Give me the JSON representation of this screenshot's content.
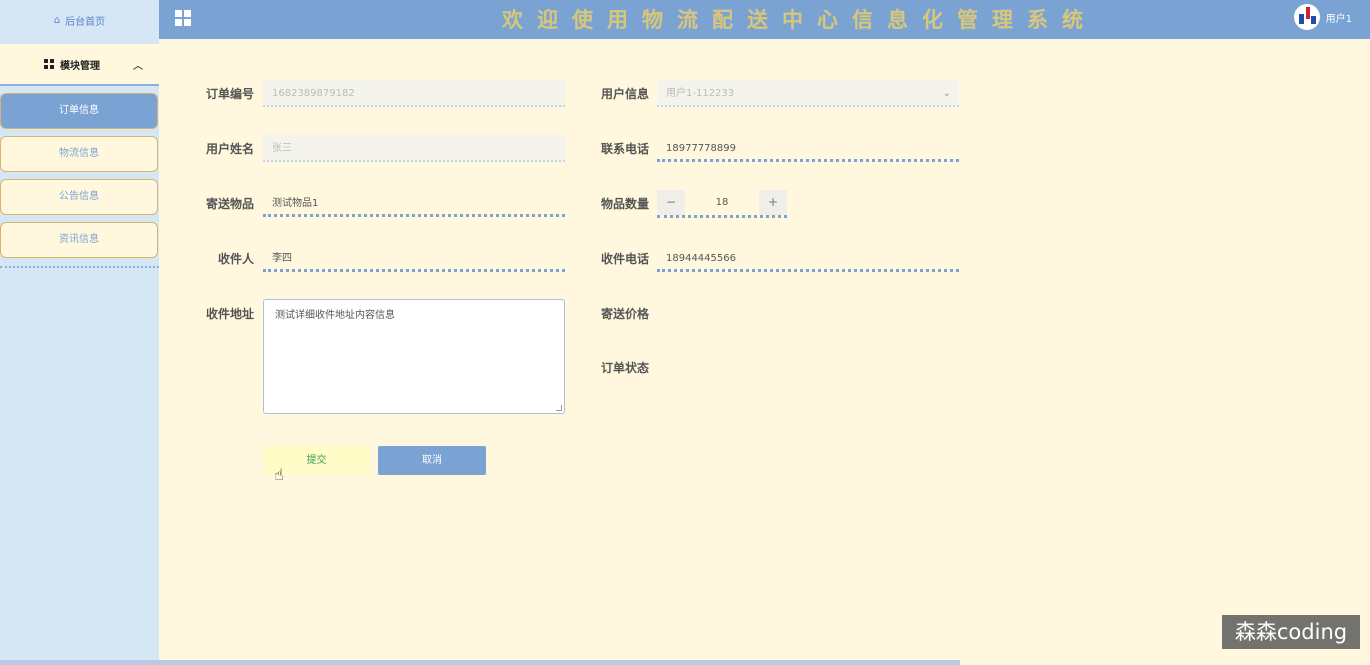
{
  "sidebar": {
    "home": "后台首页",
    "module": "模块管理",
    "items": [
      {
        "label": "订单信息"
      },
      {
        "label": "物流信息"
      },
      {
        "label": "公告信息"
      },
      {
        "label": "资讯信息"
      }
    ]
  },
  "header": {
    "title": "欢迎使用物流配送中心信息化管理系统",
    "user": "用户1"
  },
  "form": {
    "order_no": {
      "label": "订单编号",
      "value": "1682389879182"
    },
    "user_info": {
      "label": "用户信息",
      "value": "用户1-112233"
    },
    "user_name": {
      "label": "用户姓名",
      "value": "张三"
    },
    "contact_phone": {
      "label": "联系电话",
      "value": "18977778899"
    },
    "item": {
      "label": "寄送物品",
      "value": "测试物品1"
    },
    "quantity": {
      "label": "物品数量",
      "value": "18",
      "minus": "−",
      "plus": "+"
    },
    "receiver": {
      "label": "收件人",
      "value": "李四"
    },
    "receiver_phone": {
      "label": "收件电话",
      "value": "18944445566"
    },
    "address": {
      "label": "收件地址",
      "value": "测试详细收件地址内容信息"
    },
    "price": {
      "label": "寄送价格"
    },
    "status": {
      "label": "订单状态"
    },
    "submit": "提交",
    "cancel": "取消"
  },
  "watermark": "森森coding",
  "colors": {
    "primary": "#7aa3d4",
    "bg": "#fff8de",
    "sidebar": "#d5e6f5"
  }
}
